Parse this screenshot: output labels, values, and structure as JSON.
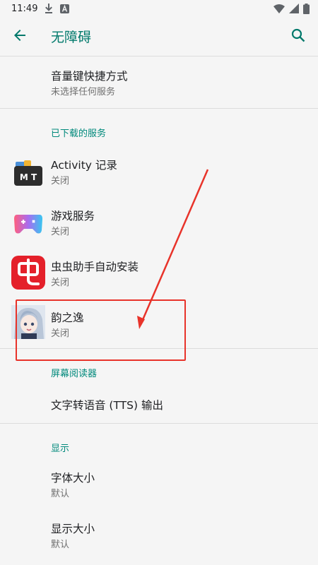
{
  "status_bar": {
    "time": "11:49",
    "icons_left": [
      "download-icon",
      "a-notification-icon"
    ],
    "icons_right": [
      "wifi-icon",
      "cellular-icon",
      "battery-icon"
    ]
  },
  "app_bar": {
    "title": "无障碍",
    "back_icon": "arrow-left-icon",
    "search_icon": "search-icon"
  },
  "items": {
    "volume_shortcut": {
      "title": "音量键快捷方式",
      "summary": "未选择任何服务"
    },
    "downloaded_services_header": "已下载的服务",
    "services": [
      {
        "title": "Activity 记录",
        "summary": "关闭",
        "icon": "mt-app-icon"
      },
      {
        "title": "游戏服务",
        "summary": "关闭",
        "icon": "gamepad-icon"
      },
      {
        "title": "虫虫助手自动安装",
        "summary": "关闭",
        "icon": "chongchong-icon"
      },
      {
        "title": "韵之逸",
        "summary": "关闭",
        "icon": "anime-avatar-icon"
      }
    ],
    "screen_reader_header": "屏幕阅读器",
    "tts": {
      "title": "文字转语音 (TTS) 输出"
    },
    "display_header": "显示",
    "font_size": {
      "title": "字体大小",
      "summary": "默认"
    },
    "display_size": {
      "title": "显示大小",
      "summary": "默认"
    }
  },
  "colors": {
    "accent": "#00796b",
    "annotation": "#e8332a",
    "background": "#f5f5f5"
  }
}
